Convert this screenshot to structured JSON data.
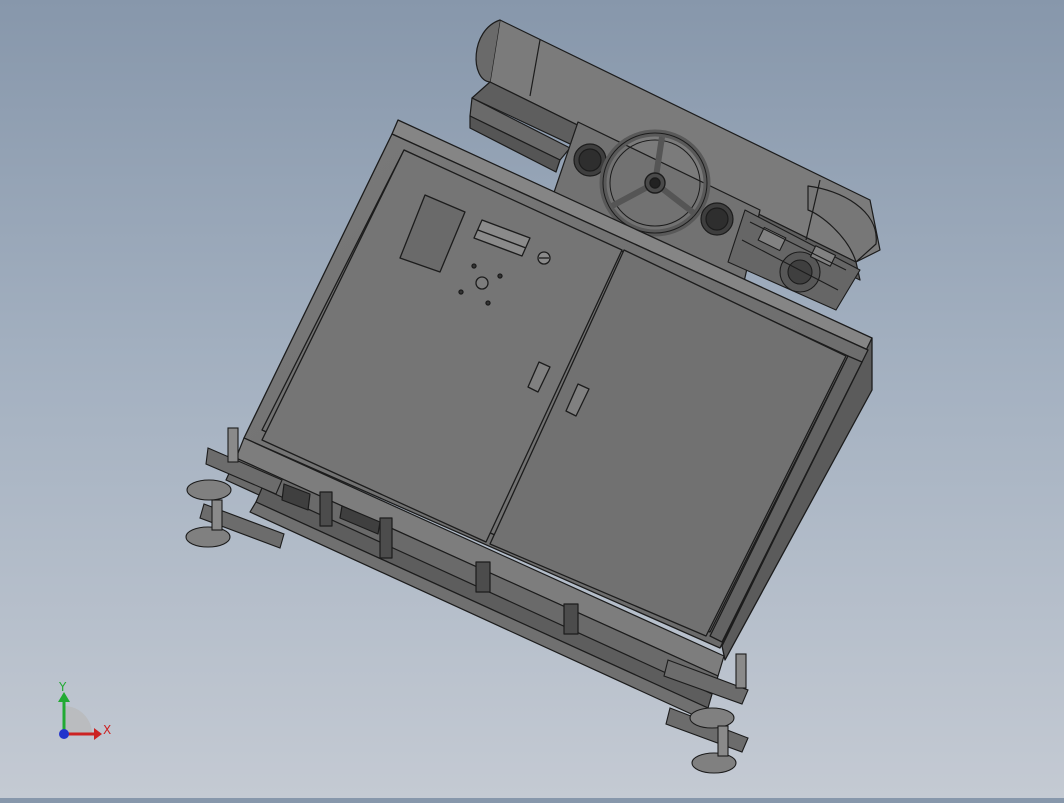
{
  "viewport": {
    "background_top": "#8797ab",
    "background_bottom": "#c4cad3",
    "model_color": "#6e6e6e",
    "edge_color": "#1c1c1c"
  },
  "model": {
    "description_icons": [
      "handwheel-icon",
      "control-panel",
      "cabinet-door",
      "leveling-foot"
    ]
  },
  "triad": {
    "x_label": "X",
    "y_label": "Y",
    "x_color": "#cc2222",
    "y_color": "#22aa33",
    "z_color": "#2233cc"
  }
}
